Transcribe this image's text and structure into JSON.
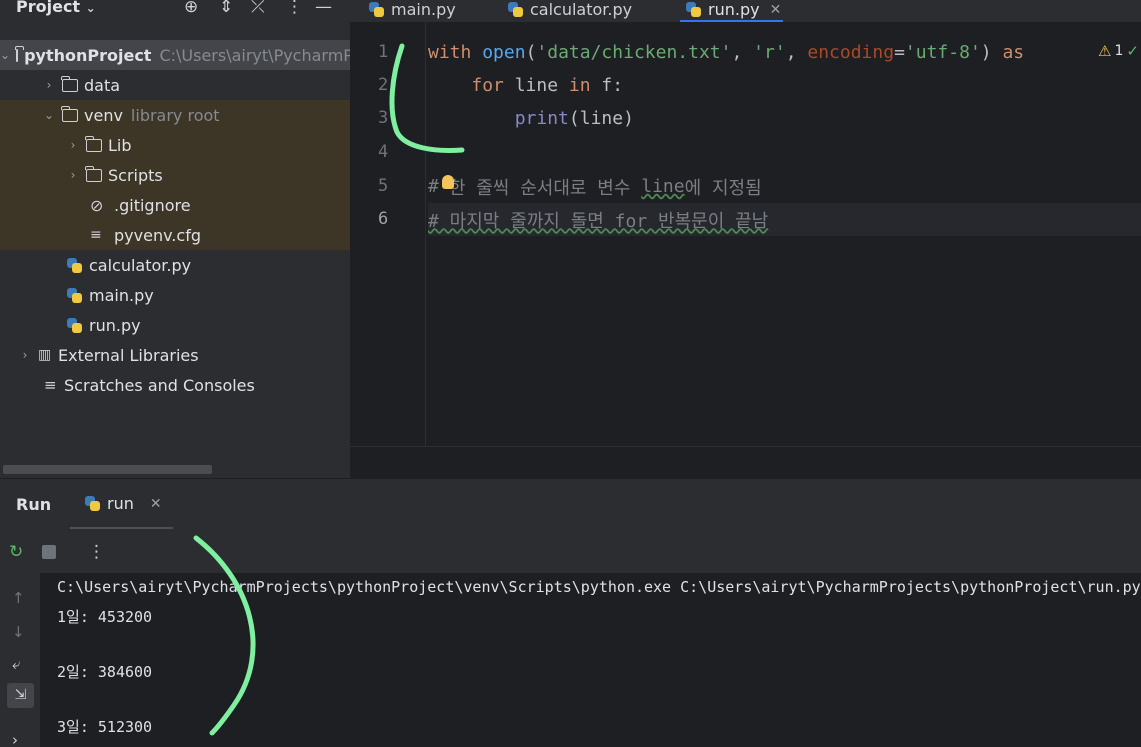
{
  "project_panel": {
    "title": "Project",
    "title_chevron": "⌄",
    "tree": [
      {
        "label": "pythonProject",
        "note": "C:\\Users\\airyt\\PycharmProjects\\pythonProject"
      },
      {
        "label": "data"
      },
      {
        "label": "venv",
        "note": "library root"
      },
      {
        "label": "Lib"
      },
      {
        "label": "Scripts"
      },
      {
        "label": ".gitignore"
      },
      {
        "label": "pyvenv.cfg"
      },
      {
        "label": "calculator.py"
      },
      {
        "label": "main.py"
      },
      {
        "label": "run.py"
      },
      {
        "label": "External Libraries"
      },
      {
        "label": "Scratches and Consoles"
      }
    ]
  },
  "tabs": [
    {
      "label": "main.py"
    },
    {
      "label": "calculator.py"
    },
    {
      "label": "run.py",
      "active": true
    }
  ],
  "editor": {
    "line_numbers": [
      "1",
      "2",
      "3",
      "4",
      "5",
      "6"
    ],
    "inspection_count": "1",
    "code": {
      "l1": {
        "t1": "with",
        "t2": "open",
        "t3": "(",
        "t4": "'data/chicken.txt'",
        "t5": ", ",
        "t6": "'r'",
        "t7": ", ",
        "t8": "encoding",
        "t9": "=",
        "t10": "'utf-8'",
        "t11": ") ",
        "t12": "as"
      },
      "l2": {
        "indent": "    ",
        "t1": "for",
        "t2": " line ",
        "t3": "in",
        "t4": " f:"
      },
      "l3": {
        "indent": "        ",
        "t1": "print",
        "t2": "(line)"
      },
      "l5": {
        "t1": "#",
        "t2": "한 줄씩 순서대로 변수 ",
        "t3": "line",
        "t4": "에 지정됨"
      },
      "l6": {
        "t1": "# 마지막 줄까지 돌면 for 반복문이 끝남"
      }
    }
  },
  "run_panel": {
    "title": "Run",
    "tab_label": "run",
    "output": [
      "C:\\Users\\airyt\\PycharmProjects\\pythonProject\\venv\\Scripts\\python.exe C:\\Users\\airyt\\PycharmProjects\\pythonProject\\run.py",
      "1일: 453200",
      "",
      "2일: 384600",
      "",
      "3일: 512300"
    ]
  },
  "colors": {
    "annotation_stroke": "#7ef0a0",
    "accent": "#3574f0"
  }
}
